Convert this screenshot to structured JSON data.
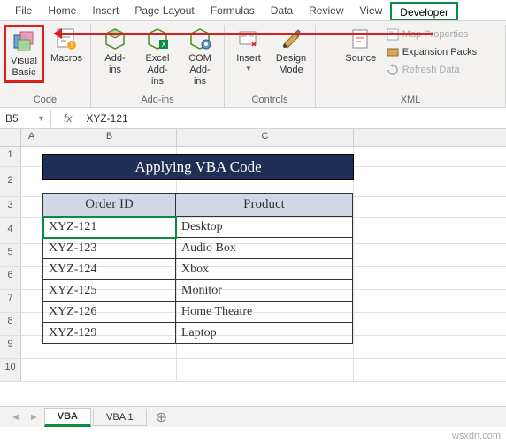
{
  "menu": {
    "tabs": [
      "File",
      "Home",
      "Insert",
      "Page Layout",
      "Formulas",
      "Data",
      "Review",
      "View",
      "Developer"
    ],
    "active": "Developer"
  },
  "ribbon": {
    "code": {
      "label": "Code",
      "visual_basic": "Visual Basic",
      "macros": "Macros"
    },
    "addins": {
      "label": "Add-ins",
      "addins": "Add-ins",
      "excel_addins": "Excel Add-ins",
      "com_addins": "COM Add-ins"
    },
    "controls": {
      "label": "Controls",
      "insert": "Insert",
      "design_mode": "Design Mode"
    },
    "xml": {
      "label": "XML",
      "source": "Source",
      "map_props": "Map Properties",
      "expansion": "Expansion Packs",
      "refresh": "Refresh Data"
    }
  },
  "formula_bar": {
    "name_box": "B5",
    "fx": "fx",
    "value": "XYZ-121"
  },
  "columns": [
    "A",
    "B",
    "C"
  ],
  "rows": [
    "1",
    "2",
    "3",
    "4",
    "5",
    "6",
    "7",
    "8",
    "9",
    "10"
  ],
  "title_banner": "Applying VBA Code",
  "table": {
    "headers": {
      "order_id": "Order ID",
      "product": "Product"
    },
    "rows": [
      {
        "id": "XYZ-121",
        "product": "Desktop"
      },
      {
        "id": "XYZ-123",
        "product": "Audio Box"
      },
      {
        "id": "XYZ-124",
        "product": "Xbox"
      },
      {
        "id": "XYZ-125",
        "product": "Monitor"
      },
      {
        "id": "XYZ-126",
        "product": "Home Theatre"
      },
      {
        "id": "XYZ-129",
        "product": "Laptop"
      }
    ]
  },
  "sheets": {
    "active": "VBA",
    "other": "VBA 1"
  },
  "watermark": "wsxdn.com"
}
